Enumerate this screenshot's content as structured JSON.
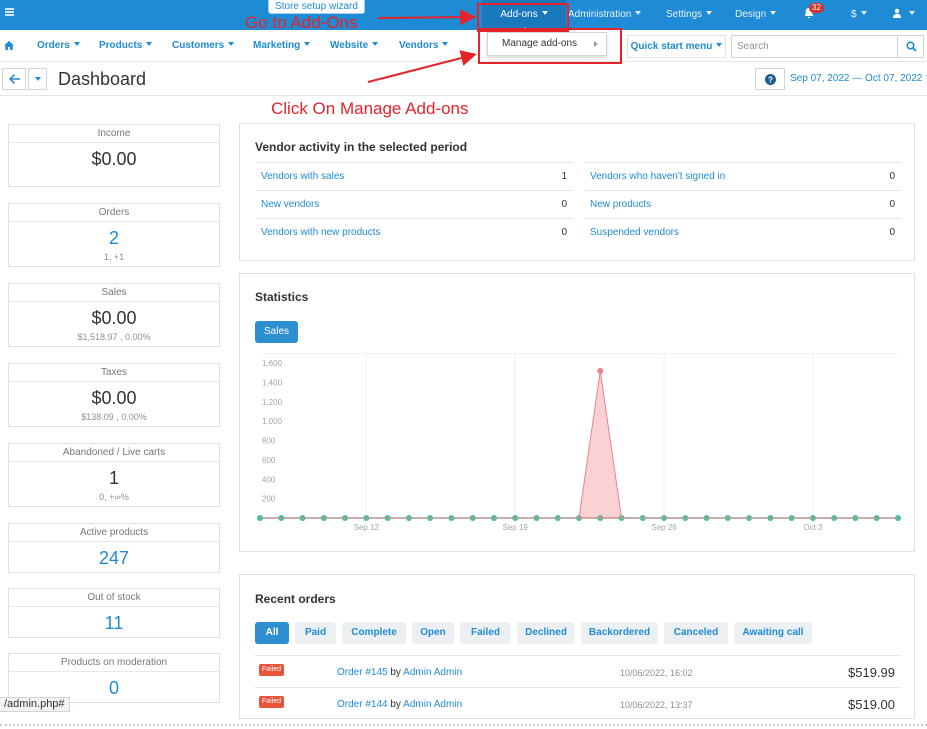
{
  "topbar": {
    "wizard_label": "Store setup wizard",
    "items": [
      "Add-ons",
      "Administration",
      "Settings",
      "Design"
    ],
    "notifications_count": "32",
    "currency": "$"
  },
  "dropdown": {
    "item": "Manage add-ons"
  },
  "annotations": {
    "goto_addons": "Go to Add-Ons",
    "click_manage": "Click On Manage Add-ons",
    "color": "#e4232b"
  },
  "secnav": {
    "items": [
      "Orders",
      "Products",
      "Customers",
      "Marketing",
      "Website",
      "Vendors"
    ],
    "quick_start": "Quick start menu",
    "search_placeholder": "Search"
  },
  "page": {
    "title": "Dashboard",
    "date_range": "Sep 07, 2022 — Oct 07, 2022"
  },
  "stats": [
    {
      "title": "Income",
      "value": "$0.00",
      "sub": ""
    },
    {
      "title": "Orders",
      "value": "2",
      "sub": "1, +1"
    },
    {
      "title": "Sales",
      "value": "$0.00",
      "sub": "$1,518.97 , 0.00%"
    },
    {
      "title": "Taxes",
      "value": "$0.00",
      "sub": "$138.09 , 0.00%"
    },
    {
      "title": "Abandoned / Live carts",
      "value": "1",
      "sub": "0, +∞%"
    },
    {
      "title": "Active products",
      "value": "247",
      "sub": ""
    },
    {
      "title": "Out of stock",
      "value": "11",
      "sub": ""
    },
    {
      "title": "Products on moderation",
      "value": "0",
      "sub": ""
    }
  ],
  "vendor_activity": {
    "title": "Vendor activity in the selected period",
    "left": [
      {
        "label": "Vendors with sales",
        "value": "1"
      },
      {
        "label": "New vendors",
        "value": "0"
      },
      {
        "label": "Vendors with new products",
        "value": "0"
      }
    ],
    "right": [
      {
        "label": "Vendors who haven't signed in",
        "value": "0"
      },
      {
        "label": "New products",
        "value": "0"
      },
      {
        "label": "Suspended vendors",
        "value": "0"
      }
    ]
  },
  "statistics": {
    "title": "Statistics",
    "tab": "Sales"
  },
  "chart_data": {
    "type": "area",
    "title": "",
    "xlabel": "",
    "ylabel": "",
    "y_ticks": [
      "1,600",
      "1,400",
      "1,200",
      "1,000",
      "800",
      "600",
      "400",
      "200"
    ],
    "x_tick_labels": [
      "Sep 12",
      "Sep 19",
      "Sep 26",
      "Oct 3"
    ],
    "ylim": [
      0,
      1600
    ],
    "x": [
      "Sep 7",
      "Sep 8",
      "Sep 9",
      "Sep 10",
      "Sep 11",
      "Sep 12",
      "Sep 13",
      "Sep 14",
      "Sep 15",
      "Sep 16",
      "Sep 17",
      "Sep 18",
      "Sep 19",
      "Sep 20",
      "Sep 21",
      "Sep 22",
      "Sep 23",
      "Sep 24",
      "Sep 25",
      "Sep 26",
      "Sep 27",
      "Sep 28",
      "Sep 29",
      "Sep 30",
      "Oct 1",
      "Oct 2",
      "Oct 3",
      "Oct 4",
      "Oct 5",
      "Oct 6",
      "Oct 7"
    ],
    "series": [
      {
        "values": [
          0,
          0,
          0,
          0,
          0,
          0,
          0,
          0,
          0,
          0,
          0,
          0,
          0,
          0,
          0,
          0,
          0,
          0,
          0,
          0,
          0,
          0,
          0,
          0,
          0,
          0,
          0,
          0,
          0,
          0,
          0
        ],
        "color": "#3cc6a0"
      },
      {
        "values": [
          0,
          0,
          0,
          0,
          0,
          0,
          0,
          0,
          0,
          0,
          0,
          0,
          0,
          0,
          0,
          0,
          1519,
          0,
          0,
          0,
          0,
          0,
          0,
          0,
          0,
          0,
          0,
          0,
          0,
          0,
          0
        ],
        "color": "#f17f89"
      }
    ]
  },
  "recent_orders": {
    "title": "Recent orders",
    "filters": [
      "All",
      "Paid",
      "Complete",
      "Open",
      "Failed",
      "Declined",
      "Backordered",
      "Canceled",
      "Awaiting call"
    ],
    "orders": [
      {
        "status": "Failed",
        "order": "Order #145",
        "by": "by",
        "customer": "Admin Admin",
        "date": "10/06/2022, 16:02",
        "total": "$519.99"
      },
      {
        "status": "Failed",
        "order": "Order #144",
        "by": "by",
        "customer": "Admin Admin",
        "date": "10/06/2022, 13:37",
        "total": "$519.00"
      }
    ]
  },
  "status_url": "/admin.php#"
}
